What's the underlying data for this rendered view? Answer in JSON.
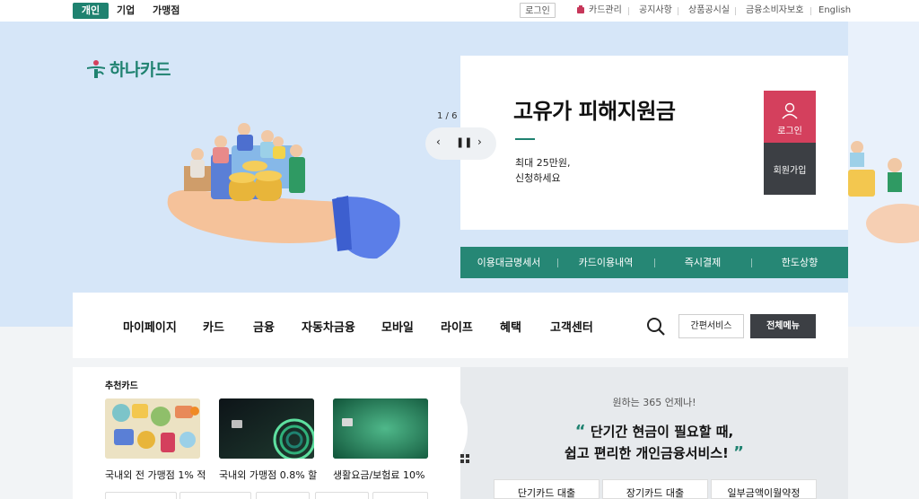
{
  "topbar": {
    "segments": [
      "개인",
      "기업",
      "가맹점"
    ],
    "login": "로그인",
    "links": [
      "카드관리",
      "공지사항",
      "상품공시실",
      "금융소비자보호",
      "English"
    ]
  },
  "brand": {
    "name": "하나카드",
    "accent": "#1f8270"
  },
  "hero": {
    "pager": "1 / 6",
    "headline": "고유가 피해지원금",
    "sub1": "최대 25만원,",
    "sub2": "신청하세요",
    "login_label": "로그인",
    "join_label": "회원가입",
    "quick_links": [
      "이용대금명세서",
      "카드이용내역",
      "즉시결제",
      "한도상향"
    ]
  },
  "nav": {
    "items": [
      "마이페이지",
      "카드",
      "금융",
      "자동차금융",
      "모바일",
      "라이프",
      "혜택",
      "고객센터"
    ],
    "easy_service": "간편서비스",
    "all_menu": "전체메뉴"
  },
  "recommended": {
    "title": "추천카드",
    "cards": [
      {
        "caption": "국내외 전 가맹점 1% 적"
      },
      {
        "caption": "국내외 가맹점 0.8% 할"
      },
      {
        "caption": "생활요금/보험료 10%"
      }
    ]
  },
  "promo": {
    "small": "원하는 365 언제나!",
    "line1": "단기간 현금이 필요할 때,",
    "line2": "쉽고 편리한 개인금융서비스!",
    "buttons": [
      "단기카드 대출",
      "장기카드 대출",
      "일부금액이월약정"
    ]
  }
}
